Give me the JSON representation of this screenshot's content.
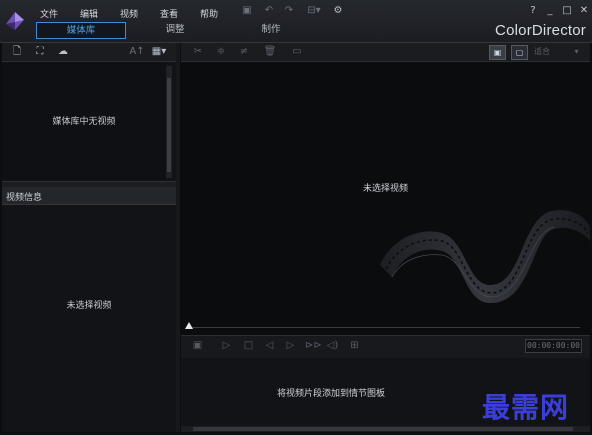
{
  "menu": {
    "file": "文件",
    "edit": "编辑",
    "view": "视频",
    "lookup": "查看",
    "help": "帮助"
  },
  "window": {
    "help": "?",
    "minimize": "_",
    "maximize": "□",
    "close": "✕"
  },
  "brand": "ColorDirector",
  "tabs": {
    "library": "媒体库",
    "adjust": "调整",
    "produce": "制作"
  },
  "library": {
    "empty_text": "媒体库中无视频",
    "text_button": "A↑"
  },
  "info": {
    "title": "视频信息",
    "empty_text": "未选择视频"
  },
  "preview": {
    "empty_text": "未选择视频",
    "fit_label": "适合"
  },
  "controls": {
    "timecode": "00:00:00:00"
  },
  "storyboard": {
    "hint": "将视频片段添加到情节图板"
  },
  "watermark": "最需网",
  "colors": {
    "accent": "#4aa3f0",
    "background": "#0c0d10",
    "watermark": "#3b3fd8"
  }
}
